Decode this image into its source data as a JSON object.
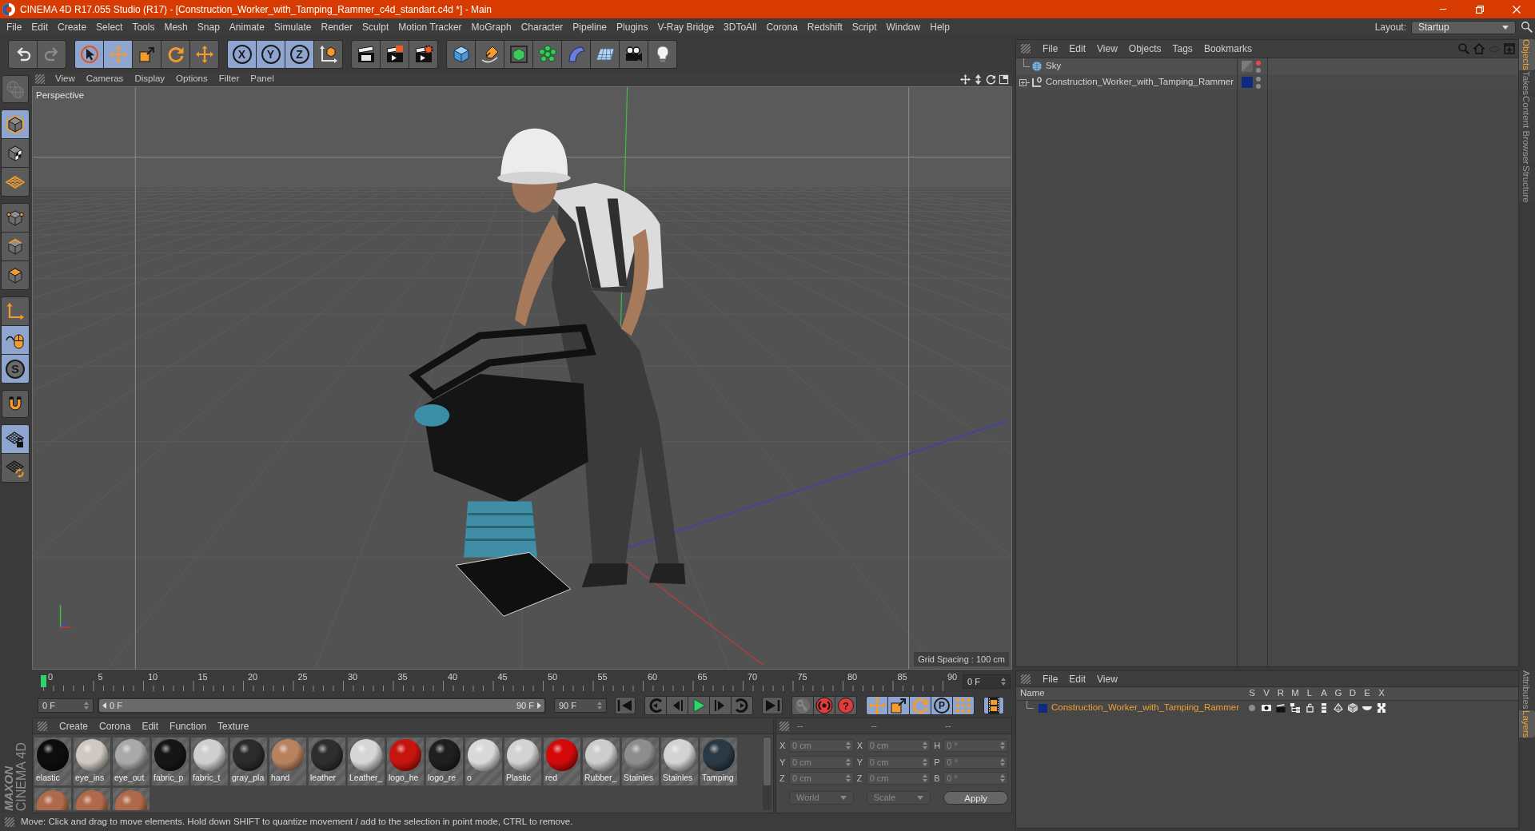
{
  "window": {
    "title": "CINEMA 4D R17.055 Studio (R17) - [Construction_Worker_with_Tamping_Rammer_c4d_standart.c4d *] - Main"
  },
  "menu": [
    "File",
    "Edit",
    "Create",
    "Select",
    "Tools",
    "Mesh",
    "Snap",
    "Animate",
    "Simulate",
    "Render",
    "Sculpt",
    "Motion Tracker",
    "MoGraph",
    "Character",
    "Pipeline",
    "Plugins",
    "V-Ray Bridge",
    "3DToAll",
    "Corona",
    "Redshift",
    "Script",
    "Window",
    "Help"
  ],
  "layout": {
    "label": "Layout:",
    "value": "Startup"
  },
  "toolbar": [
    {
      "active": false,
      "disabled": false
    },
    {
      "active": false,
      "disabled": true
    },
    {
      "active": true,
      "disabled": false
    },
    {
      "active": true,
      "disabled": false
    },
    {
      "active": false,
      "disabled": false
    },
    {
      "active": false,
      "disabled": false
    },
    {
      "active": false,
      "disabled": false
    },
    {
      "label": "X",
      "active": true,
      "disabled": false
    },
    {
      "label": "Y",
      "active": true,
      "disabled": false
    },
    {
      "label": "Z",
      "active": true,
      "disabled": false
    },
    {
      "active": false,
      "disabled": false
    },
    {
      "active": false,
      "disabled": false
    },
    {
      "active": false,
      "disabled": false
    },
    {
      "active": false,
      "disabled": false
    },
    {
      "active": false,
      "disabled": false
    },
    {
      "active": false,
      "disabled": false
    },
    {
      "active": false,
      "disabled": false
    },
    {
      "active": false,
      "disabled": false
    },
    {
      "active": false,
      "disabled": false
    },
    {
      "active": false,
      "disabled": false
    },
    {
      "active": false,
      "disabled": false
    },
    {
      "active": false,
      "disabled": false
    }
  ],
  "tools": [
    {
      "active": false,
      "disabled": true
    },
    {
      "active": true,
      "disabled": false
    },
    {
      "active": false,
      "disabled": false
    },
    {
      "active": false,
      "disabled": false
    },
    {
      "active": false,
      "disabled": false
    },
    {
      "active": false,
      "disabled": false
    },
    {
      "active": false,
      "disabled": false
    },
    {
      "active": false,
      "disabled": false
    },
    {
      "active": true,
      "disabled": false
    },
    {
      "label": "S",
      "active": true,
      "disabled": false
    },
    {
      "active": false,
      "disabled": false
    },
    {
      "active": true,
      "disabled": false
    },
    {
      "active": false,
      "disabled": false
    }
  ],
  "viewport": {
    "menu": [
      "View",
      "Cameras",
      "Display",
      "Options",
      "Filter",
      "Panel"
    ],
    "camera": "Perspective",
    "grid_spacing": "Grid Spacing : 100 cm"
  },
  "timeline": {
    "ticks": [
      "0",
      "5",
      "10",
      "15",
      "20",
      "25",
      "30",
      "35",
      "40",
      "45",
      "50",
      "55",
      "60",
      "65",
      "70",
      "75",
      "80",
      "85",
      "90"
    ],
    "level": 0,
    "frame": "0 F"
  },
  "transport": {
    "start": "0 F",
    "range": {
      "start_label": "0 F",
      "end_label": "90 F",
      "level": 1
    },
    "end": "90 F",
    "buttons": [
      {
        "active": false,
        "disabled": false
      },
      {
        "active": false,
        "disabled": false
      },
      {
        "active": false,
        "disabled": false
      },
      {
        "active": false,
        "disabled": false
      },
      {
        "active": false,
        "disabled": false
      },
      {
        "active": false,
        "disabled": false
      },
      {
        "active": false,
        "disabled": false
      },
      {
        "active": false,
        "disabled": true
      },
      {
        "active": false,
        "disabled": false
      },
      {
        "label": "?",
        "active": false,
        "disabled": false
      },
      {
        "active": true,
        "disabled": false
      },
      {
        "active": true,
        "disabled": false
      },
      {
        "active": true,
        "disabled": false
      },
      {
        "label": "P",
        "active": true,
        "disabled": false
      },
      {
        "active": true,
        "disabled": false
      },
      {
        "active": true,
        "disabled": false
      }
    ]
  },
  "materials": {
    "menu": [
      "Create",
      "Corona",
      "Edit",
      "Function",
      "Texture"
    ],
    "items": [
      {
        "name": "elastic",
        "color": "#0d0d0d"
      },
      {
        "name": "eye_ins",
        "color": "#cfc8c0"
      },
      {
        "name": "eye_out",
        "color": "#a9a9a9"
      },
      {
        "name": "fabric_p",
        "color": "#161616"
      },
      {
        "name": "fabric_t",
        "color": "#cfcfcf"
      },
      {
        "name": "gray_pla",
        "color": "#2b2b2b"
      },
      {
        "name": "hand",
        "color": "#b9825f"
      },
      {
        "name": "leather",
        "color": "#2e2e2e"
      },
      {
        "name": "Leather_",
        "color": "#d6d6d6"
      },
      {
        "name": "logo_he",
        "color": "#c8140e"
      },
      {
        "name": "logo_re",
        "color": "#1f1f1f"
      },
      {
        "name": "o",
        "color": "#d9d9d9"
      },
      {
        "name": "Plastic",
        "color": "#d2d2d2"
      },
      {
        "name": "red",
        "color": "#d40a0a"
      },
      {
        "name": "Rubber_",
        "color": "#cdcdcd"
      },
      {
        "name": "Stainles",
        "color": "#8d8d8d"
      },
      {
        "name": "Stainles",
        "color": "#d3d3d3"
      },
      {
        "name": "Tamping",
        "color": "#2a3a44"
      },
      {
        "color": "#b0694a"
      },
      {
        "color": "#b0694a"
      },
      {
        "color": "#b0694a"
      }
    ]
  },
  "coordinates": {
    "headers": [
      "--",
      "--",
      "--"
    ],
    "rows": [
      [
        {
          "axis": "X",
          "value": "0 cm"
        },
        {
          "axis": "X",
          "value": "0 cm"
        },
        {
          "axis": "H",
          "value": "0 °"
        }
      ],
      [
        {
          "axis": "Y",
          "value": "0 cm"
        },
        {
          "axis": "Y",
          "value": "0 cm"
        },
        {
          "axis": "P",
          "value": "0 °"
        }
      ],
      [
        {
          "axis": "Z",
          "value": "0 cm"
        },
        {
          "axis": "Z",
          "value": "0 cm"
        },
        {
          "axis": "B",
          "value": "0 °"
        }
      ]
    ],
    "disabled": true,
    "dropdowns": [
      "World",
      "Scale"
    ],
    "button": "Apply"
  },
  "objects": {
    "menu": [
      "File",
      "Edit",
      "View",
      "Objects",
      "Tags",
      "Bookmarks"
    ],
    "items": [
      {
        "name": "Sky",
        "kind": "sky",
        "selected": false,
        "editor_hidden": true,
        "render_hidden": false
      },
      {
        "name": "Construction_Worker_with_Tamping_Rammer",
        "kind": "null",
        "expanded": false,
        "selected": false,
        "color": "#0f2a80",
        "editor_hidden": false,
        "render_hidden": false
      }
    ]
  },
  "object_tabs": [
    {
      "label": "Objects",
      "selected": true
    },
    {
      "label": "Takes",
      "selected": false
    },
    {
      "label": "Content Browser",
      "selected": false
    },
    {
      "label": "Structure",
      "selected": false
    }
  ],
  "layers": {
    "menu": [
      "File",
      "Edit",
      "View"
    ],
    "columns": [
      "Name",
      "S",
      "V",
      "R",
      "M",
      "L",
      "A",
      "G",
      "D",
      "E",
      "X"
    ],
    "items": [
      {
        "name": "Construction_Worker_with_Tamping_Rammer",
        "color": "#0f2a80",
        "selected": true
      }
    ]
  },
  "layer_tabs": [
    {
      "label": "Attributes",
      "selected": false
    },
    {
      "label": "Layers",
      "selected": true
    }
  ],
  "logo": {
    "brand": "MAXON",
    "product": "CINEMA 4D"
  },
  "status_bar": "Move: Click and drag to move elements. Hold down SHIFT to quantize movement / add to the selection in point mode, CTRL to remove."
}
